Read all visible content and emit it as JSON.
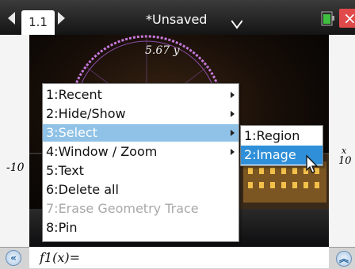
{
  "tab": {
    "label": "1.1"
  },
  "document": {
    "title": "*Unsaved"
  },
  "graph": {
    "y_max_label": "5.67",
    "y_var": "y",
    "x_min_label": "-10",
    "x_max_label": "10",
    "x_var": "x"
  },
  "menu": {
    "items": [
      {
        "label": "1:Recent",
        "has_submenu": true
      },
      {
        "label": "2:Hide/Show",
        "has_submenu": true
      },
      {
        "label": "3:Select",
        "has_submenu": true,
        "selected": true
      },
      {
        "label": "4:Window / Zoom",
        "has_submenu": true
      },
      {
        "label": "5:Text"
      },
      {
        "label": "6:Delete all"
      },
      {
        "label": "7:Erase Geometry Trace",
        "disabled": true
      },
      {
        "label": "8:Pin"
      }
    ]
  },
  "submenu": {
    "items": [
      {
        "label": "1:Region"
      },
      {
        "label": "2:Image",
        "selected": true
      }
    ]
  },
  "entry": {
    "func": "f1",
    "arg": "x",
    "suffix": "="
  },
  "icons": {
    "expand_left": "double-left-chevron-icon",
    "expand_right": "double-up-chevron-icon",
    "close": "close-icon",
    "battery": "battery-icon",
    "cursor": "mouse-pointer-icon"
  },
  "colors": {
    "menu_highlight": "#8fc2e6",
    "submenu_highlight": "#2f8fd8",
    "close": "#e04a4a"
  }
}
